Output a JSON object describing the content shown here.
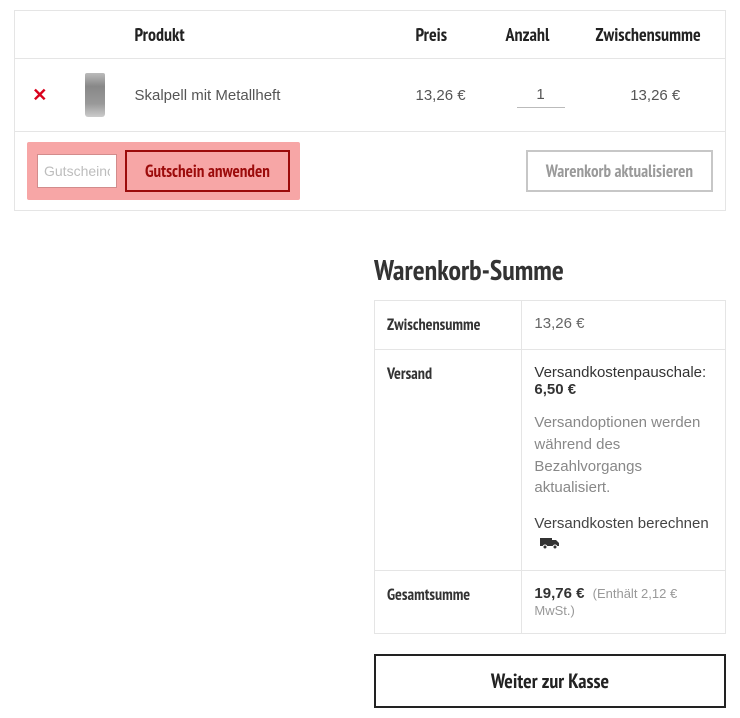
{
  "cart": {
    "headers": {
      "product": "Produkt",
      "price": "Preis",
      "qty": "Anzahl",
      "subtotal": "Zwischensumme"
    },
    "items": [
      {
        "name": "Skalpell mit Metallheft",
        "price": "13,26 €",
        "qty": "1",
        "subtotal": "13,26 €"
      }
    ],
    "coupon": {
      "placeholder": "Gutscheincode",
      "apply_label": "Gutschein anwenden"
    },
    "update_label": "Warenkorb aktualisieren"
  },
  "totals": {
    "title": "Warenkorb-Summe",
    "rows": {
      "subtotal_label": "Zwischensumme",
      "subtotal_value": "13,26 €",
      "shipping_label": "Versand",
      "shipping_title": "Versandkostenpauschale:",
      "shipping_cost": "6,50 €",
      "shipping_note": "Versandoptionen werden während des Bezahlvorgangs aktualisiert.",
      "shipping_calc": "Versandkosten berechnen",
      "total_label": "Gesamtsumme",
      "total_value": "19,76 €",
      "tax_note": "(Enthält 2,12 € MwSt.)"
    }
  },
  "checkout_label": "Weiter zur Kasse"
}
